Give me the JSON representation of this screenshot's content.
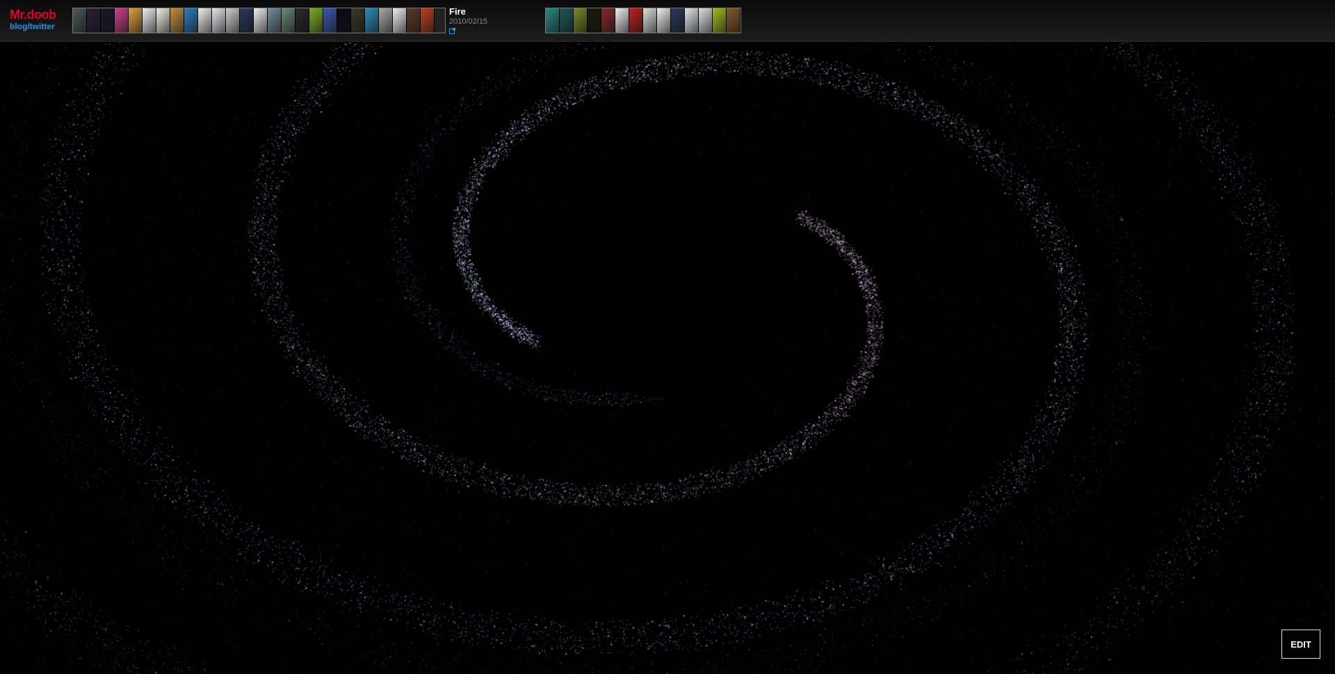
{
  "header": {
    "logo_name": "Mr.doob",
    "logo_links": "blog/twitter",
    "current_item": {
      "title": "Fire",
      "date": "2010/02/15",
      "external_link_icon": "external-link-icon"
    }
  },
  "thumbnail_strip_left": {
    "colors": [
      "#4a5a5a",
      "#2a1f3a",
      "#1a1a2a",
      "#d04090",
      "#e0a040",
      "#f0f0f0",
      "#f5f0e0",
      "#c89040",
      "#2c80c0",
      "#f0f0f0",
      "#e8e8f0",
      "#d0d0d0",
      "#2a3a5a",
      "#f0f0f0",
      "#7090a0",
      "#6a8a7a",
      "#2a2a2a",
      "#7ab020",
      "#3a5ab0",
      "#0a0a1a",
      "#3a3a2a",
      "#2a90c0",
      "#aaaaaa",
      "#f0f0f0",
      "#5a3a2a",
      "#c04020"
    ]
  },
  "thumbnail_strip_right": {
    "colors": [
      "#2a8a8a",
      "#1a5a5a",
      "#7a8a2a",
      "#1a1a0a",
      "#8a2a2a",
      "#f0f0f0",
      "#c02020",
      "#e0e0e0",
      "#f0f0f0",
      "#2a3a5a",
      "#e0e8f0",
      "#e0e0e0",
      "#a0c020",
      "#8a5a2a"
    ]
  },
  "edit_button": {
    "label": "EDIT"
  },
  "colors": {
    "logo_red": "#e0002c",
    "link_blue": "#2a8fe6",
    "background": "#000000"
  }
}
